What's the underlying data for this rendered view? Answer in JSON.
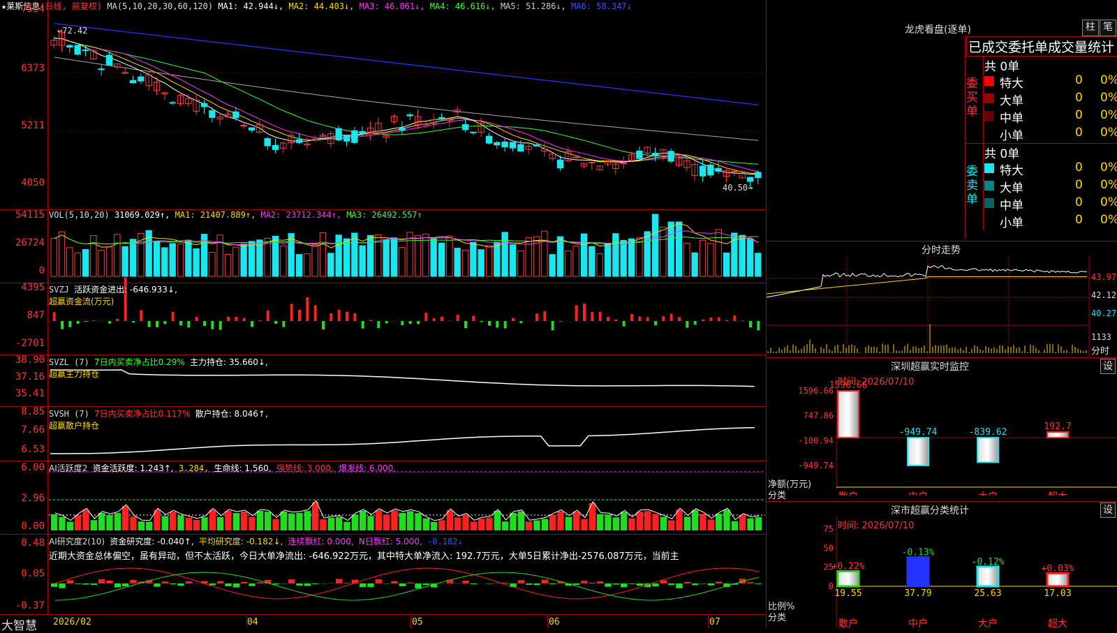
{
  "colors": {
    "up": "#ff3b3b",
    "down": "#19e6ef",
    "ma1": "#ffffff",
    "ma2": "#ffd700",
    "ma3": "#ff33ff",
    "ma4": "#33ff33",
    "ma5": "#aaaaaa",
    "ma6": "#2233ff",
    "grid": "#aa0000"
  },
  "main": {
    "title": "★莱斯信息",
    "title_mode": "(日线, 前复权)",
    "ma_label": "MA(5,10,20,30,60,120)",
    "ma1": "MA1: 42.944↓,",
    "ma2": "MA2: 44.403↓,",
    "ma3": "MA3: 46.061↓,",
    "ma4": "MA4: 46.616↓,",
    "ma5": "MA5: 51.286↓,",
    "ma6": "MA6: 58.347↓",
    "y_ticks": [
      "7534",
      "6373",
      "5211",
      "4050"
    ],
    "high_label": "←72.42",
    "low_label": "40.50→"
  },
  "vol": {
    "label": "VOL(5,10,20)",
    "value": "31069.029↑,",
    "ma1": "MA1: 21407.889↑,",
    "ma2": "MA2: 23712.344↑,",
    "ma3": "MA3: 26492.557↑",
    "y_ticks": [
      "54115",
      "26724",
      "0"
    ]
  },
  "svzj": {
    "label": "SVZJ",
    "text": "活跃资金进出: -646.933↓,",
    "sub": "超赢资金流(万元)",
    "y_ticks": [
      "4395",
      "847",
      "-2701"
    ]
  },
  "svzl": {
    "label": "SVZL (7)",
    "t1": "7日内买卖净占比0.29%",
    "t2": "主力持仓: 35.660↓,",
    "sub": "超赢主力持仓",
    "y_ticks": [
      "38.90",
      "37.16",
      "35.41"
    ]
  },
  "svsh": {
    "label": "SVSH (7)",
    "t1": "7日内买卖净占比0.117%",
    "t2": "散户持仓: 8.046↑,",
    "sub": "超赢散户持仓",
    "y_ticks": [
      "8.85",
      "7.66",
      "6.53"
    ]
  },
  "ai1": {
    "label": "AI活跃度2",
    "t1": "资金活跃度: 1.243↑,",
    "t2": "3.284,",
    "t3": "生命线: 1.560,",
    "t4": "强势线: 3.000,",
    "t5": "爆发线: 6.000,",
    "y_ticks": [
      "6.00",
      "2.96",
      "0.00"
    ]
  },
  "ai2": {
    "label": "AI研究度2(10)",
    "t1": "资金研究度: -0.040↑,",
    "t2": "平均研究度: -0.182↓,",
    "t3": "连续飘红: 0.000,",
    "t4": "N日飘红: 5.000,",
    "t5": "-0.182↓",
    "note": "近期大资金总体偏空，虽有异动，但不太活跃，今日大单净流出: -646.922万元，其中特大单净流入: 192.7万元，大单5日累计净出-2576.087万元，当前主",
    "y_ticks": [
      "0.48",
      "0.05",
      "-0.37"
    ]
  },
  "xaxis": {
    "brand": "大智慧",
    "labels": [
      "2026/02",
      "04",
      "05",
      "06",
      "07"
    ]
  },
  "lhb": {
    "title": "龙虎看盘(逐单)",
    "btn1": "柱",
    "btn2": "笔",
    "header": "已成交委托单成交量统计",
    "buy_total": "共 0单",
    "sell_total": "共 0单",
    "buy_label": "委买单",
    "sell_label": "委卖单",
    "buy_rows": [
      {
        "name": "特大",
        "val": "0",
        "pct": "0%"
      },
      {
        "name": "大单",
        "val": "0",
        "pct": "0%"
      },
      {
        "name": "中单",
        "val": "0",
        "pct": "0%"
      },
      {
        "name": "小单",
        "val": "0",
        "pct": "0%"
      }
    ],
    "sell_rows": [
      {
        "name": "特大",
        "val": "0",
        "pct": "0%"
      },
      {
        "name": "大单",
        "val": "0",
        "pct": "0%"
      },
      {
        "name": "中单",
        "val": "0",
        "pct": "0%"
      },
      {
        "name": "小单",
        "val": "0",
        "pct": "0%"
      }
    ]
  },
  "fenshi": {
    "title": "分时走势",
    "y_ticks": [
      "43.97",
      "42.12",
      "40.27"
    ],
    "vol_tick": "1133",
    "vol_unit": "分时"
  },
  "monitor": {
    "title": "深圳超赢实时监控",
    "btn": "设",
    "time": "时间: 2026/07/10",
    "y_ticks": [
      "1596.66",
      "747.86",
      "-100.94",
      "-949.74"
    ],
    "ylabel1": "净额(万元)",
    "ylabel2": "分类",
    "bars": [
      {
        "cat": "散户",
        "val": 1596.66,
        "label": "1596.66"
      },
      {
        "cat": "中户",
        "val": -949.74,
        "label": "-949.74"
      },
      {
        "cat": "大户",
        "val": -839.62,
        "label": "-839.62"
      },
      {
        "cat": "超大",
        "val": 192.7,
        "label": "192.7"
      }
    ]
  },
  "stats": {
    "title": "深市超赢分类统计",
    "btn": "设",
    "time": "时间: 2026/07/10",
    "y_ticks": [
      "75",
      "50",
      "25",
      "0"
    ],
    "ylabel1": "比例%",
    "ylabel2": "分类",
    "bars": [
      {
        "cat": "散户",
        "val": 19.55,
        "label": "19.55",
        "chg": "+0.22%"
      },
      {
        "cat": "中户",
        "val": 37.79,
        "label": "37.79",
        "chg": "-0.13%"
      },
      {
        "cat": "大户",
        "val": 25.63,
        "label": "25.63",
        "chg": "-0.12%"
      },
      {
        "cat": "超大",
        "val": 17.03,
        "label": "17.03",
        "chg": "+0.03%"
      }
    ]
  }
}
